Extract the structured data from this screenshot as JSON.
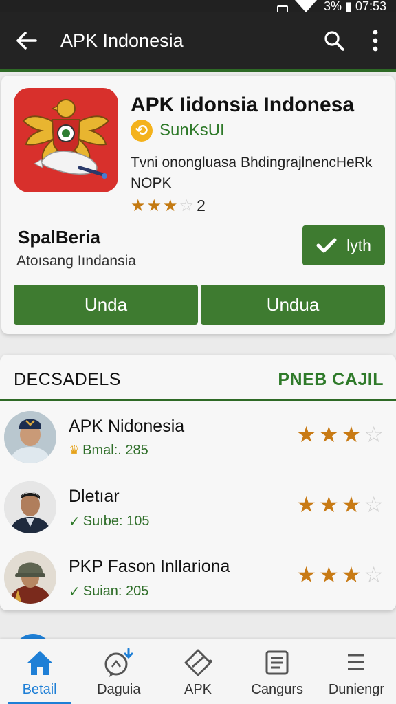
{
  "status_bar": {
    "text": "3% ▮ 07:53"
  },
  "app_bar": {
    "title": "APK Indonesia",
    "back_icon": "arrow-left-icon",
    "search_icon": "search-icon",
    "menu_icon": "more-vert-icon"
  },
  "app": {
    "name": "APK Iidonsia Indonesa",
    "developer": "SunKsUI",
    "description": "Tvni onongluasa BhdingrajlnencHeRk NOPK",
    "rating": {
      "stars": 3,
      "max": 4,
      "count": "2"
    },
    "section_title": "SpalBeria",
    "section_subtitle": "Atoısang Iındansia",
    "install_label": "lyth",
    "buttons": [
      "Unda",
      "Undua"
    ]
  },
  "list": {
    "header_left": "DECSADELS",
    "header_right": "PNEB CAJIL",
    "items": [
      {
        "name": "APK Nidonesia",
        "meta": "Bmal:. 285",
        "meta_icon": "crown-icon",
        "stars": 3,
        "max": 4
      },
      {
        "name": "Dletıar",
        "meta": "Suıbe: 105",
        "meta_icon": "check-icon",
        "stars": 3,
        "max": 4
      },
      {
        "name": "PKP Fason Inllariona",
        "meta": "Suian: 205",
        "meta_icon": "check-icon",
        "stars": 3,
        "max": 4
      }
    ]
  },
  "bottom_nav": [
    {
      "label": "Betail",
      "icon": "home-icon",
      "active": true
    },
    {
      "label": "Daguia",
      "icon": "chat-download-icon",
      "active": false
    },
    {
      "label": "APK",
      "icon": "tag-icon",
      "active": false
    },
    {
      "label": "Cangurs",
      "icon": "list-box-icon",
      "active": false
    },
    {
      "label": "Duniengr",
      "icon": "menu-lines-icon",
      "active": false
    }
  ],
  "colors": {
    "accent_green": "#3e7b30",
    "link_green": "#2f7a2a",
    "app_bar": "#232323",
    "nav_active": "#1e7fd6",
    "star": "#c47a12"
  }
}
